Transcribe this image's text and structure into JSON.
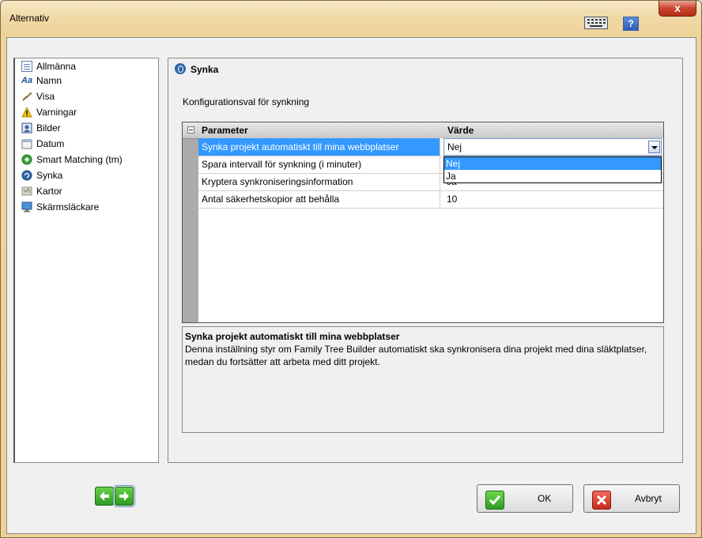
{
  "window": {
    "title": "Alternativ",
    "help_label": "?",
    "close_label": "x"
  },
  "sidebar": {
    "items": [
      {
        "label": "Allmänna",
        "icon": "general-icon"
      },
      {
        "label": "Namn",
        "icon": "text-icon"
      },
      {
        "label": "Visa",
        "icon": "brush-icon"
      },
      {
        "label": "Varningar",
        "icon": "warning-icon"
      },
      {
        "label": "Bilder",
        "icon": "picture-icon"
      },
      {
        "label": "Datum",
        "icon": "calendar-icon"
      },
      {
        "label": "Smart Matching (tm)",
        "icon": "smart-matching-icon"
      },
      {
        "label": "Synka",
        "icon": "sync-icon",
        "selected": true
      },
      {
        "label": "Kartor",
        "icon": "map-icon"
      },
      {
        "label": "Skärmsläckare",
        "icon": "monitor-icon"
      }
    ]
  },
  "section": {
    "title": "Synka",
    "description": "Konfigurationsval för synkning"
  },
  "grid": {
    "headers": {
      "parameter": "Parameter",
      "value": "Värde"
    },
    "rows": [
      {
        "parameter": "Synka projekt automatiskt till mina webbplatser",
        "value": "Nej"
      },
      {
        "parameter": "Spara intervall för synkning (i minuter)",
        "value": ""
      },
      {
        "parameter": "Kryptera synkroniseringsinformation",
        "value": "Ja"
      },
      {
        "parameter": "Antal säkerhetskopior att behålla",
        "value": "10"
      }
    ],
    "dropdown_options": [
      "Nej",
      "Ja"
    ]
  },
  "info": {
    "title": "Synka projekt automatiskt till mina webbplatser",
    "text": "Denna inställning styr om Family Tree Builder automatiskt ska synkronisera dina projekt med dina släktplatser, medan du fortsätter att arbeta med ditt projekt."
  },
  "buttons": {
    "ok": "OK",
    "cancel": "Avbryt"
  },
  "colors": {
    "selection": "#3399ff",
    "title_bar": "#f1d9a6"
  }
}
